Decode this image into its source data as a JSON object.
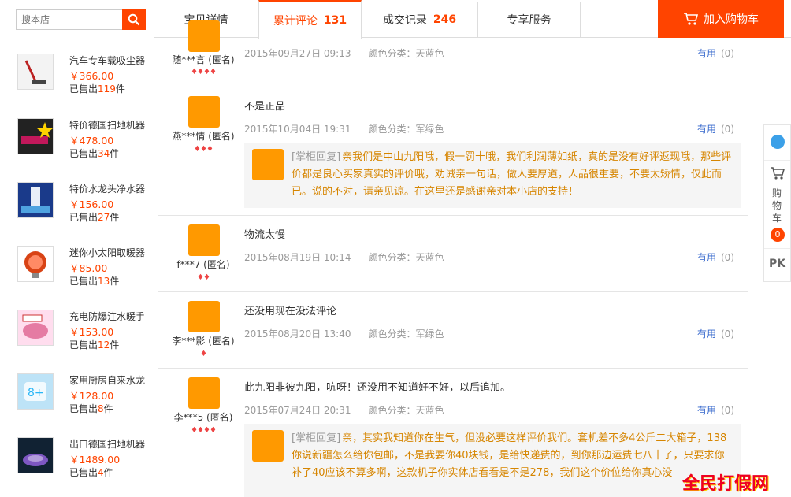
{
  "search": {
    "placeholder": "搜本店"
  },
  "tabs": [
    {
      "label": "宝贝详情",
      "count": ""
    },
    {
      "label": "累计评论",
      "count": "131"
    },
    {
      "label": "成交记录",
      "count": "246"
    },
    {
      "label": "专享服务",
      "count": ""
    }
  ],
  "cart_button": {
    "label": "加入购物车"
  },
  "products": [
    {
      "name": "汽车专车载吸尘器",
      "price": "￥366.00",
      "sold_prefix": "已售出",
      "sold": "119",
      "sold_suffix": "件"
    },
    {
      "name": "特价德国扫地机器",
      "price": "￥478.00",
      "sold_prefix": "已售出",
      "sold": "34",
      "sold_suffix": "件"
    },
    {
      "name": "特价水龙头净水器",
      "price": "￥156.00",
      "sold_prefix": "已售出",
      "sold": "27",
      "sold_suffix": "件"
    },
    {
      "name": "迷你小太阳取暖器",
      "price": "￥85.00",
      "sold_prefix": "已售出",
      "sold": "13",
      "sold_suffix": "件"
    },
    {
      "name": "充电防爆注水暖手",
      "price": "￥153.00",
      "sold_prefix": "已售出",
      "sold": "12",
      "sold_suffix": "件"
    },
    {
      "name": "家用厨房自来水龙",
      "price": "￥128.00",
      "sold_prefix": "已售出",
      "sold": "8",
      "sold_suffix": "件"
    },
    {
      "name": "出口德国扫地机器",
      "price": "￥1489.00",
      "sold_prefix": "已售出",
      "sold": "4",
      "sold_suffix": "件"
    }
  ],
  "reviews": [
    {
      "user": "随***言 (匿名)",
      "hearts": "♦♦♦♦",
      "text": "",
      "date": "2015年09月27日 09:13",
      "sku": "颜色分类：天蓝色",
      "useful": "有用",
      "useful_count": "(0)"
    },
    {
      "user": "燕***情 (匿名)",
      "hearts": "♦♦♦",
      "text": "不是正品",
      "date": "2015年10月04日 19:31",
      "sku": "颜色分类：军绿色",
      "useful": "有用",
      "useful_count": "(0)",
      "reply_tag": "[掌柜回复]",
      "reply": "亲我们是中山九阳哦，假一罚十哦，我们利润薄如纸，真的是没有好评返现哦，那些评价都是良心买家真实的评价哦，劝诫亲一句话，做人要厚道，人品很重要，不要太矫情，仅此而已。说的不对，请亲见谅。在这里还是感谢亲对本小店的支持！"
    },
    {
      "user": "f***7 (匿名)",
      "hearts": "♦♦",
      "text": "物流太慢",
      "date": "2015年08月19日 10:14",
      "sku": "颜色分类：天蓝色",
      "useful": "有用",
      "useful_count": "(0)"
    },
    {
      "user": "李***影 (匿名)",
      "hearts": "♦",
      "text": "还没用现在没法评论",
      "date": "2015年08月20日 13:40",
      "sku": "颜色分类：军绿色",
      "useful": "有用",
      "useful_count": "(0)"
    },
    {
      "user": "李***5 (匿名)",
      "hearts": "♦♦♦♦",
      "text": "此九阳非彼九阳，吭呀！还没用不知道好不好，以后追加。",
      "date": "2015年07月24日 20:31",
      "sku": "颜色分类：天蓝色",
      "useful": "有用",
      "useful_count": "(0)",
      "reply_tag": "[掌柜回复]",
      "reply": "亲，其实我知道你在生气，但没必要这样评价我们。套机差不多4公斤二大箱子，138你说新疆怎么给你包邮，不是我要你40块钱，是给快递费的，到你那边运费七八十了，只要求你补了40应该不算多啊，这款机子你实体店看看是不是278，我们这个价位给你真心没"
    }
  ],
  "sidebar": {
    "cart_label": "购物车",
    "cart_count": "0",
    "pk_label": "PK"
  },
  "watermark": "全民打假网",
  "colors": {
    "accent": "#ff4400",
    "reply_text": "#d68500",
    "link": "#3366cc"
  }
}
